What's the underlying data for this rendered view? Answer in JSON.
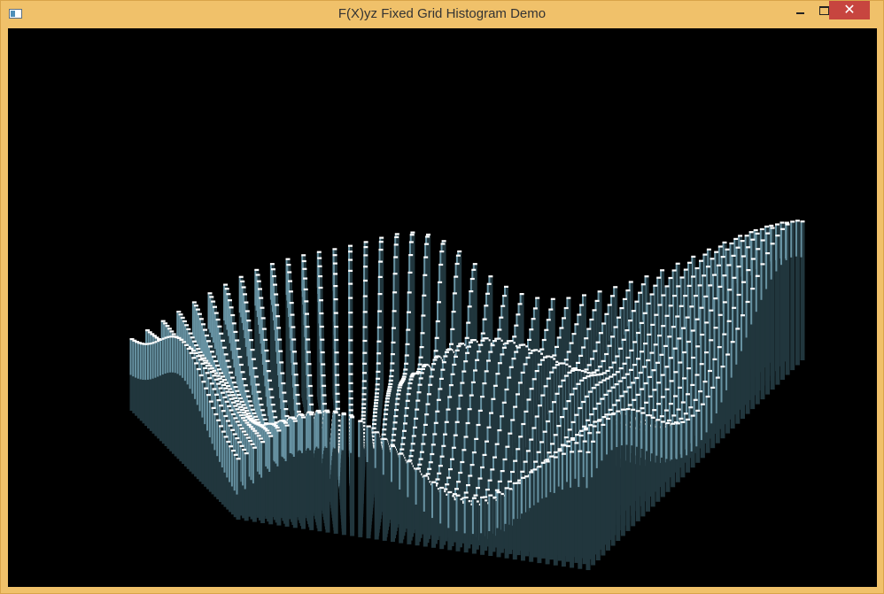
{
  "window": {
    "title": "F(X)yz Fixed Grid Histogram Demo",
    "minimize_glyph": "",
    "close_glyph": "✕"
  },
  "colors": {
    "frame": "#f0c16a",
    "close_button": "#c7453f",
    "canvas": "#000000",
    "bar_face": "#7fb2c4",
    "bar_side": "#21363d",
    "bar_top": "#ffffff"
  },
  "icons": {
    "app": "window-app-icon",
    "minimize": "minimize-icon",
    "maximize": "maximize-icon",
    "close": "close-icon"
  },
  "histogram": {
    "type": "3d-fixed-grid-histogram",
    "grid": "dense square grid of vertical bars",
    "surface": "wavy height field with several peaks and valleys"
  }
}
